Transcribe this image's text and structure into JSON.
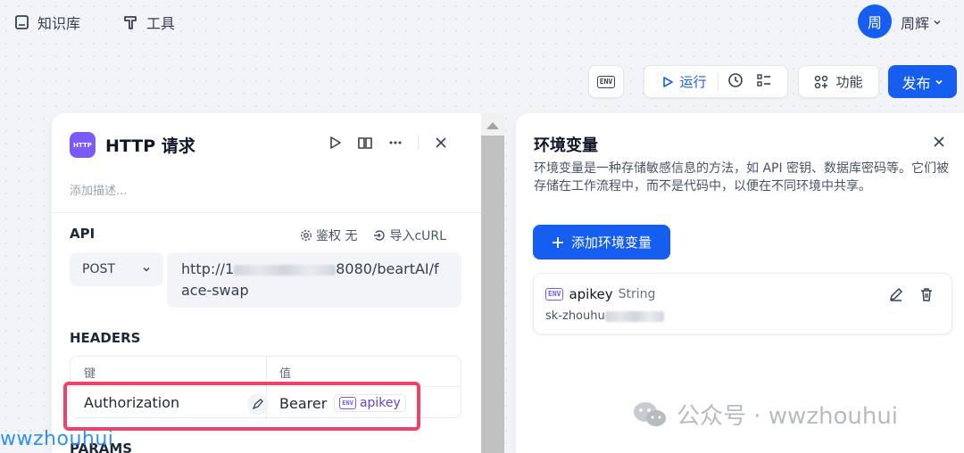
{
  "nav": {
    "knowledge": "知识库",
    "tools": "工具"
  },
  "user": {
    "avatar_char": "周",
    "name": "周辉"
  },
  "toolbar": {
    "env": "ENV",
    "run": "运行",
    "features": "功能",
    "publish": "发布"
  },
  "node": {
    "icon_text": "HTTP",
    "title": "HTTP 请求",
    "description_placeholder": "添加描述...",
    "api_label": "API",
    "auth_label": "鉴权 无",
    "import_curl": "导入cURL",
    "method": "POST",
    "url_prefix": "http://1",
    "url_suffix": "8080/beartAI/face-swap",
    "headers_label": "HEADERS",
    "col_key": "键",
    "col_value": "值",
    "header_key": "Authorization",
    "header_value": "Bearer",
    "header_var": "apikey",
    "params_label": "PARAMS"
  },
  "env_panel": {
    "title": "环境变量",
    "description": "环境变量是一种存储敏感信息的方法，如 API 密钥、数据库密码等。它们被存储在工作流程中，而不是代码中，以便在不同环境中共享。",
    "add_button": "添加环境变量",
    "variable": {
      "name": "apikey",
      "type": "String",
      "value": "sk-zhouhu"
    }
  },
  "watermarks": {
    "bottom_left": "wwzhouhui",
    "bottom_right": "公众号 · wwzhouhui"
  },
  "colors": {
    "primary": "#155eef",
    "node_icon": "#7a5af8",
    "highlight": "#f04266"
  }
}
